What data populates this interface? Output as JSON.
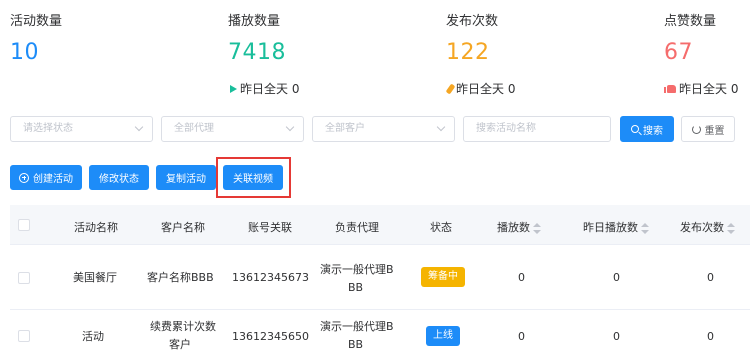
{
  "stats": [
    {
      "label": "活动数量",
      "value": "10",
      "color": "#1d8cf8",
      "sub": null
    },
    {
      "label": "播放数量",
      "value": "7418",
      "color": "#19be9b",
      "sub": "昨日全天 0",
      "icon": "play-icon"
    },
    {
      "label": "发布次数",
      "value": "122",
      "color": "#f5a623",
      "sub": "昨日全天 0",
      "icon": "pen-icon"
    },
    {
      "label": "点赞数量",
      "value": "67",
      "color": "#f56c6c",
      "sub": "昨日全天 0",
      "icon": "thumb-up-icon"
    }
  ],
  "filters": {
    "status_placeholder": "请选择状态",
    "agent_placeholder": "全部代理",
    "customer_placeholder": "全部客户",
    "search_placeholder": "搜索活动名称",
    "search_label": "搜索",
    "reset_label": "重置"
  },
  "actions": {
    "create_label": "创建活动",
    "modify_status_label": "修改状态",
    "copy_label": "复制活动",
    "link_video_label": "关联视频"
  },
  "table": {
    "columns": [
      "活动名称",
      "客户名称",
      "账号关联",
      "负责代理",
      "状态",
      "播放数",
      "昨日播放数",
      "发布次数"
    ],
    "rows": [
      {
        "name": "美国餐厅",
        "customer_1": "客户名称BBB",
        "customer_2": "",
        "account": "13612345673",
        "agent_1": "演示一般代理B",
        "agent_2": "BB",
        "status": "筹备中",
        "status_color": "#f5b400",
        "plays": "0",
        "yesterday_plays": "0",
        "publishes": "0"
      },
      {
        "name": "活动",
        "customer_1": "续费累计次数",
        "customer_2": "客户",
        "account": "13612345650",
        "agent_1": "演示一般代理B",
        "agent_2": "BB",
        "status": "上线",
        "status_color": "#1d8cf8",
        "plays": "0",
        "yesterday_plays": "0",
        "publishes": "0"
      }
    ]
  }
}
